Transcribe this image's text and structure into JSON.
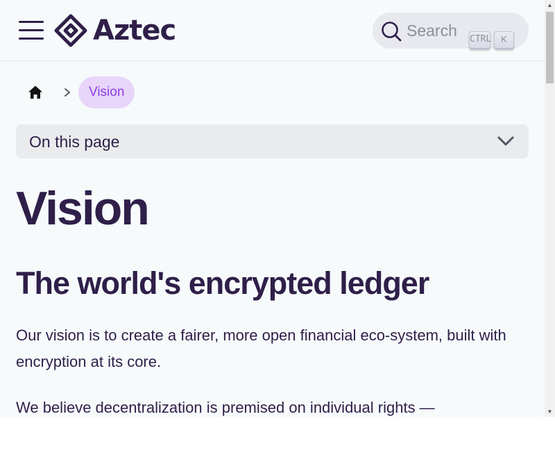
{
  "navbar": {
    "brand": "Aztec",
    "search_placeholder": "Search",
    "shortcut_keys": [
      "CTRL",
      "K"
    ]
  },
  "breadcrumb": {
    "current": "Vision"
  },
  "toc": {
    "label": "On this page"
  },
  "article": {
    "title": "Vision",
    "subtitle": "The world's encrypted ledger",
    "paragraphs": [
      "Our vision is to create a fairer, more open financial eco-system, built with encryption at its core.",
      "We believe decentralization is premised on individual rights —"
    ]
  },
  "theme": {
    "primary_text": "#2f1f49",
    "accent_purple": "#8a3ee0",
    "accent_purple_bg": "#e8d6fa",
    "page_bg": "#f6fafb"
  }
}
